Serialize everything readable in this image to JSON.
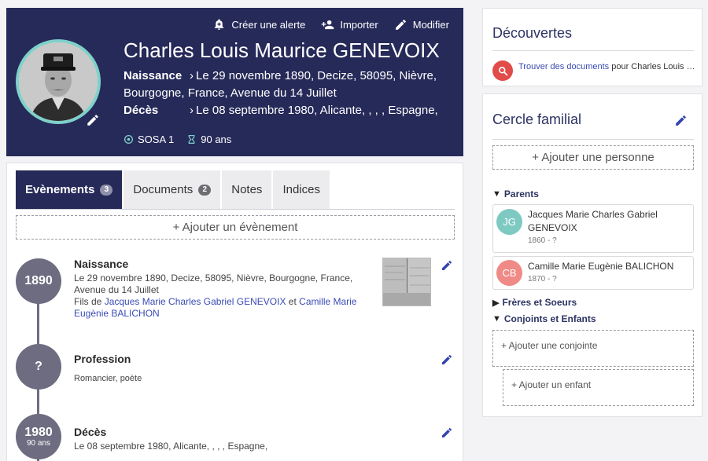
{
  "hero": {
    "actions": [
      {
        "label": "Créer une alerte",
        "icon": "bell-plus-icon"
      },
      {
        "label": "Importer",
        "icon": "person-add-icon"
      },
      {
        "label": "Modifier",
        "icon": "pencil-icon"
      }
    ],
    "name": "Charles Louis Maurice GENEVOIX",
    "birth_label": "Naissance",
    "birth_text": "Le 29 novembre 1890, Decize, 58095, Nièvre, Bourgogne, France, Avenue du 14 Juillet",
    "death_label": "Décès",
    "death_text": "Le 08 septembre 1980, Alicante, , , , Espagne,",
    "sosa": "SOSA 1",
    "age": "90 ans"
  },
  "tabs": [
    {
      "label": "Evènements",
      "count": "3",
      "active": true
    },
    {
      "label": "Documents",
      "count": "2",
      "active": false
    },
    {
      "label": "Notes",
      "count": null,
      "active": false
    },
    {
      "label": "Indices",
      "count": null,
      "active": false
    }
  ],
  "add_event_label": "+ Ajouter un évènement",
  "events": {
    "birth": {
      "year": "1890",
      "title": "Naissance",
      "line1": "Le 29 novembre 1890, Decize, 58095, Nièvre, Bourgogne, France,",
      "line2": "Avenue du 14 Juillet",
      "son_of": "Fils de",
      "father": "Jacques Marie Charles Gabriel GENEVOIX",
      "and": "et",
      "mother_part1": "Camille Marie",
      "mother_part2": "Eugènie BALICHON"
    },
    "profession": {
      "year": "?",
      "title": "Profession",
      "text": "Romancier, poète"
    },
    "death": {
      "year": "1980",
      "age": "90 ans",
      "title": "Décès",
      "text": "Le 08 septembre 1980, Alicante, , , , Espagne,"
    }
  },
  "discover": {
    "title": "Découvertes",
    "link": "Trouver des documents",
    "rest": " pour Charles Louis M..."
  },
  "family": {
    "title": "Cercle familial",
    "add_person": "+ Ajouter une personne",
    "parents_label": "Parents",
    "father": {
      "initials": "JG",
      "name": "Jacques Marie Charles Gabriel GENEVOIX",
      "dates": "1860 - ?",
      "color": "#7ec9c2"
    },
    "mother": {
      "initials": "CB",
      "name": "Camille Marie Eugènie BALICHON",
      "dates": "1870 - ?",
      "color": "#f08a86"
    },
    "siblings_label": "Frères et Soeurs",
    "spouses_label": "Conjoints et Enfants",
    "add_spouse": "+ Ajouter une conjointe",
    "add_child": "+ Ajouter un enfant"
  },
  "colors": {
    "header_bg": "#262a59",
    "accent_blue": "#3344b0",
    "ring": "#7fd1c9",
    "timeline": "#6e6c80",
    "discover_icon": "#e14b48"
  }
}
